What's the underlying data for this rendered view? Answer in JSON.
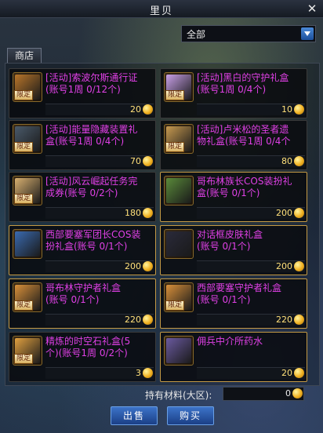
{
  "window": {
    "title": "里贝"
  },
  "filter": {
    "selected": "全部"
  },
  "tabs": [
    {
      "label": "商店"
    }
  ],
  "items": [
    {
      "name": "[活动]索波尔斯通行证\n(账号1周 0/12个)",
      "price": "20",
      "badge": "限定",
      "icon_color": "#b8752a"
    },
    {
      "name": "[活动]黑白的守护礼盒\n(账号1周 0/4个)",
      "price": "10",
      "badge": "限定",
      "icon_color": "#c8a0e8"
    },
    {
      "name": "[活动]能量隐藏装置礼\n盒(账号1周 0/4个)",
      "price": "70",
      "badge": "限定",
      "icon_color": "#4a5a6a"
    },
    {
      "name": "[活动]卢米松的圣者遗\n物礼盒(账号1周 0/4个",
      "price": "80",
      "badge": "限定",
      "icon_color": "#c89a50"
    },
    {
      "name": "[活动]风云崛起任务完\n成券(账号 0/2个)",
      "price": "180",
      "badge": "限定",
      "icon_color": "#d8b070"
    },
    {
      "name": "哥布林族长COS装扮礼\n盒(账号 0/1个)",
      "price": "200",
      "badge": "",
      "icon_color": "#5a8a3a"
    },
    {
      "name": "西部要塞军团长COS装\n扮礼盒(账号 0/1个)",
      "price": "200",
      "badge": "",
      "icon_color": "#3a6ab0"
    },
    {
      "name": "对话框皮肤礼盒\n(账号 0/1个)",
      "price": "200",
      "badge": "",
      "icon_color": "#2a2a3a"
    },
    {
      "name": "哥布林守护者礼盒\n(账号 0/1个)",
      "price": "220",
      "badge": "限定",
      "icon_color": "#d8903a"
    },
    {
      "name": "西部要塞守护者礼盒\n(账号 0/1个)",
      "price": "220",
      "badge": "限定",
      "icon_color": "#d8903a"
    },
    {
      "name": "精炼的时空石礼盒(5\n个)(账号1周 0/2个)",
      "price": "3",
      "badge": "限定",
      "icon_color": "#e0a040"
    },
    {
      "name": "佣兵中介所药水",
      "price": "20",
      "badge": "",
      "icon_color": "#6a5aa0"
    }
  ],
  "footer": {
    "material_label": "持有材料(大区):",
    "material_value": "0",
    "sell_label": "出售",
    "buy_label": "购买"
  }
}
